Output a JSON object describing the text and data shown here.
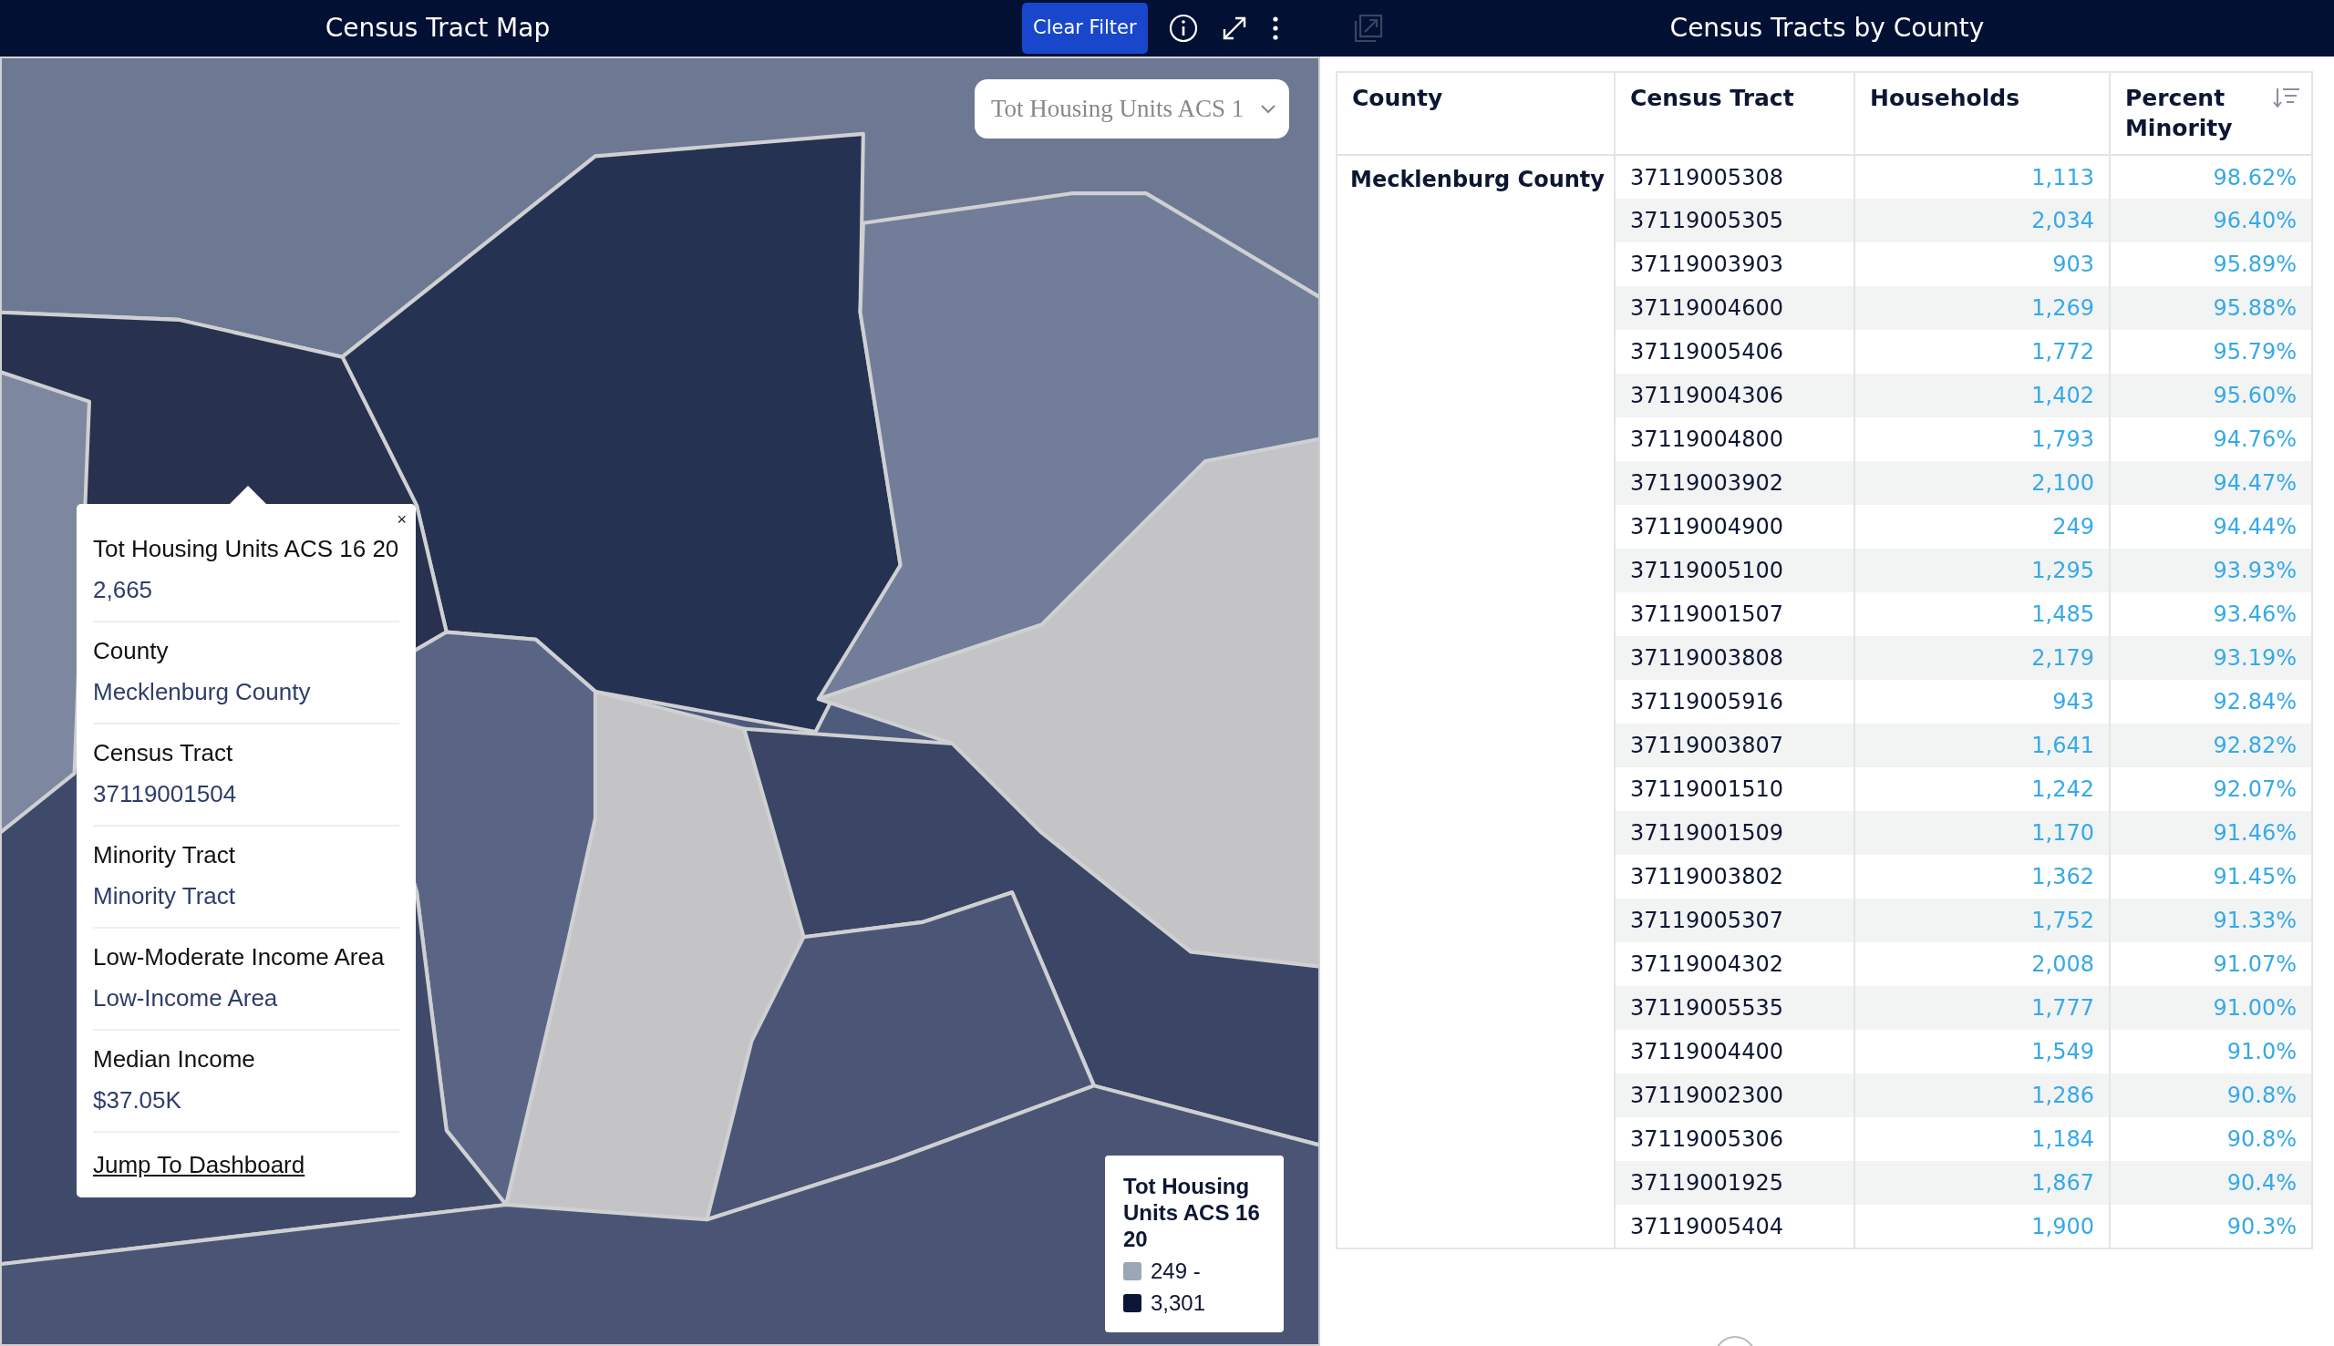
{
  "map_panel": {
    "title": "Census Tract Map",
    "clear_filter": "Clear Filter",
    "measure_select": {
      "value": "Tot Housing Units ACS 1"
    },
    "popup": {
      "close": "×",
      "fields": [
        {
          "label": "Tot Housing Units ACS 16 20",
          "value": "2,665"
        },
        {
          "label": "County",
          "value": "Mecklenburg County"
        },
        {
          "label": "Census Tract",
          "value": "37119001504"
        },
        {
          "label": "Minority Tract",
          "value": "Minority Tract"
        },
        {
          "label": "Low-Moderate Income Area",
          "value": "Low-Income Area"
        },
        {
          "label": "Median Income",
          "value": "$37.05K"
        }
      ],
      "link": "Jump To Dashboard"
    },
    "legend": {
      "title": "Tot Housing Units ACS 16 20",
      "stops": [
        {
          "label": "249 -",
          "color": "#9ba6b7"
        },
        {
          "label": "3,301",
          "color": "#0b1638"
        }
      ]
    }
  },
  "table_panel": {
    "title": "Census Tracts by County",
    "columns": [
      {
        "label": "County",
        "sorted": false
      },
      {
        "label": "Census Tract",
        "sorted": false
      },
      {
        "label": "Households",
        "sorted": false
      },
      {
        "label": "Percent Minority",
        "sorted": true
      }
    ],
    "groups": [
      {
        "county": "Mecklenburg County",
        "rows": [
          {
            "tract": "37119005308",
            "households": "1,113",
            "percent": "98.62%"
          },
          {
            "tract": "37119005305",
            "households": "2,034",
            "percent": "96.40%"
          },
          {
            "tract": "37119003903",
            "households": "903",
            "percent": "95.89%"
          },
          {
            "tract": "37119004600",
            "households": "1,269",
            "percent": "95.88%"
          },
          {
            "tract": "37119005406",
            "households": "1,772",
            "percent": "95.79%"
          },
          {
            "tract": "37119004306",
            "households": "1,402",
            "percent": "95.60%"
          },
          {
            "tract": "37119004800",
            "households": "1,793",
            "percent": "94.76%"
          },
          {
            "tract": "37119003902",
            "households": "2,100",
            "percent": "94.47%"
          },
          {
            "tract": "37119004900",
            "households": "249",
            "percent": "94.44%"
          },
          {
            "tract": "37119005100",
            "households": "1,295",
            "percent": "93.93%"
          },
          {
            "tract": "37119001507",
            "households": "1,485",
            "percent": "93.46%"
          },
          {
            "tract": "37119003808",
            "households": "2,179",
            "percent": "93.19%"
          },
          {
            "tract": "37119005916",
            "households": "943",
            "percent": "92.84%"
          },
          {
            "tract": "37119003807",
            "households": "1,641",
            "percent": "92.82%"
          },
          {
            "tract": "37119001510",
            "households": "1,242",
            "percent": "92.07%"
          },
          {
            "tract": "37119001509",
            "households": "1,170",
            "percent": "91.46%"
          },
          {
            "tract": "37119003802",
            "households": "1,362",
            "percent": "91.45%"
          },
          {
            "tract": "37119005307",
            "households": "1,752",
            "percent": "91.33%"
          },
          {
            "tract": "37119004302",
            "households": "2,008",
            "percent": "91.07%"
          },
          {
            "tract": "37119005535",
            "households": "1,777",
            "percent": "91.00%"
          },
          {
            "tract": "37119004400",
            "households": "1,549",
            "percent": "91.0%"
          },
          {
            "tract": "37119002300",
            "households": "1,286",
            "percent": "90.8%"
          },
          {
            "tract": "37119005306",
            "households": "1,184",
            "percent": "90.8%"
          },
          {
            "tract": "37119001925",
            "households": "1,867",
            "percent": "90.4%"
          },
          {
            "tract": "37119005404",
            "households": "1,900",
            "percent": "90.3%"
          }
        ]
      }
    ]
  }
}
